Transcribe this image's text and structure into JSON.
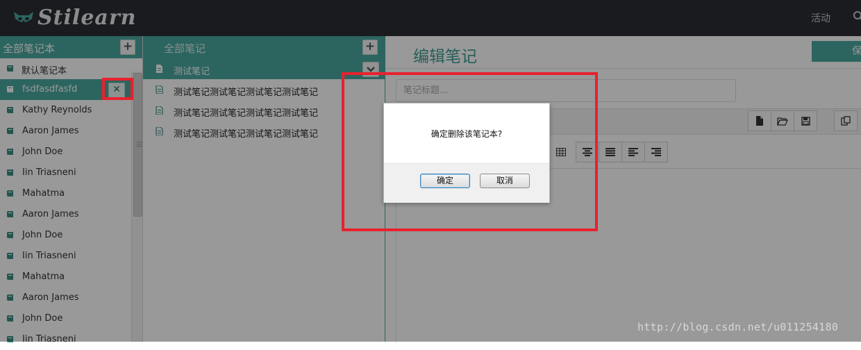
{
  "app": {
    "logo_text": "Stilearn",
    "nav_activity": "活动"
  },
  "notebooks": {
    "header": "全部笔记本",
    "items": [
      {
        "label": "默认笔记本"
      },
      {
        "label": "fsdfasdfasfd",
        "active": true
      },
      {
        "label": "Kathy Reynolds"
      },
      {
        "label": "Aaron James"
      },
      {
        "label": "John Doe"
      },
      {
        "label": "Iin Triasneni"
      },
      {
        "label": "Mahatma"
      },
      {
        "label": "Aaron James"
      },
      {
        "label": "John Doe"
      },
      {
        "label": "Iin Triasneni"
      },
      {
        "label": "Mahatma"
      },
      {
        "label": "Aaron James"
      },
      {
        "label": "John Doe"
      },
      {
        "label": "Iin Triasneni"
      }
    ]
  },
  "notes": {
    "header": "全部笔记",
    "items": [
      {
        "label": "测试笔记",
        "active": true
      },
      {
        "label": "测试笔记测试笔记测试笔记测试笔记"
      },
      {
        "label": "测试笔记测试笔记测试笔记测试笔记"
      },
      {
        "label": "测试笔记测试笔记测试笔记测试笔记"
      }
    ]
  },
  "editor": {
    "title": "编辑笔记",
    "save_label": "保",
    "title_placeholder": "笔记标题...",
    "toolbar_icons": [
      "new-file-icon",
      "open-folder-icon",
      "save-icon",
      "copy-icon"
    ],
    "format_icons": [
      "table-icon",
      "align-center-icon",
      "align-justify-icon",
      "align-left-icon",
      "align-right-icon"
    ]
  },
  "dialog": {
    "message": "确定删除该笔记本?",
    "confirm_label": "确定",
    "cancel_label": "取消"
  },
  "colors": {
    "accent": "#4aa99f",
    "topbar": "#2b2e33",
    "highlight_red": "#e8212e"
  },
  "watermark": "http://blog.csdn.net/u011254180"
}
